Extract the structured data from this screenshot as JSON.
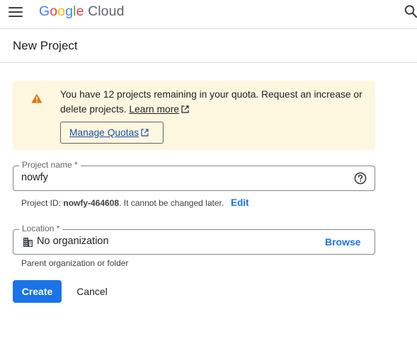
{
  "header": {
    "logo_google": [
      "G",
      "o",
      "o",
      "g",
      "l",
      "e"
    ],
    "logo_cloud": "Cloud",
    "menu_icon": "hamburger-menu-icon",
    "search_icon": "search-icon"
  },
  "page": {
    "title": "New Project"
  },
  "quota_notice": {
    "message": "You have 12 projects remaining in your quota. Request an increase or delete projects.",
    "learn_more": "Learn more",
    "manage_label": "Manage Quotas",
    "background_color": "#fef7e0",
    "icon": "warning-icon"
  },
  "project_name": {
    "label": "Project name *",
    "value": "nowfy",
    "help_icon": "help-icon",
    "id_prefix": "Project ID: ",
    "id_value": "nowfy-464608",
    "id_suffix": ". It cannot be changed later.",
    "edit_label": "Edit"
  },
  "location": {
    "label": "Location *",
    "value": "No organization",
    "browse_label": "Browse",
    "helper": "Parent organization or folder",
    "icon": "building-icon"
  },
  "actions": {
    "create_label": "Create",
    "cancel_label": "Cancel",
    "primary_color": "#1a73e8"
  }
}
